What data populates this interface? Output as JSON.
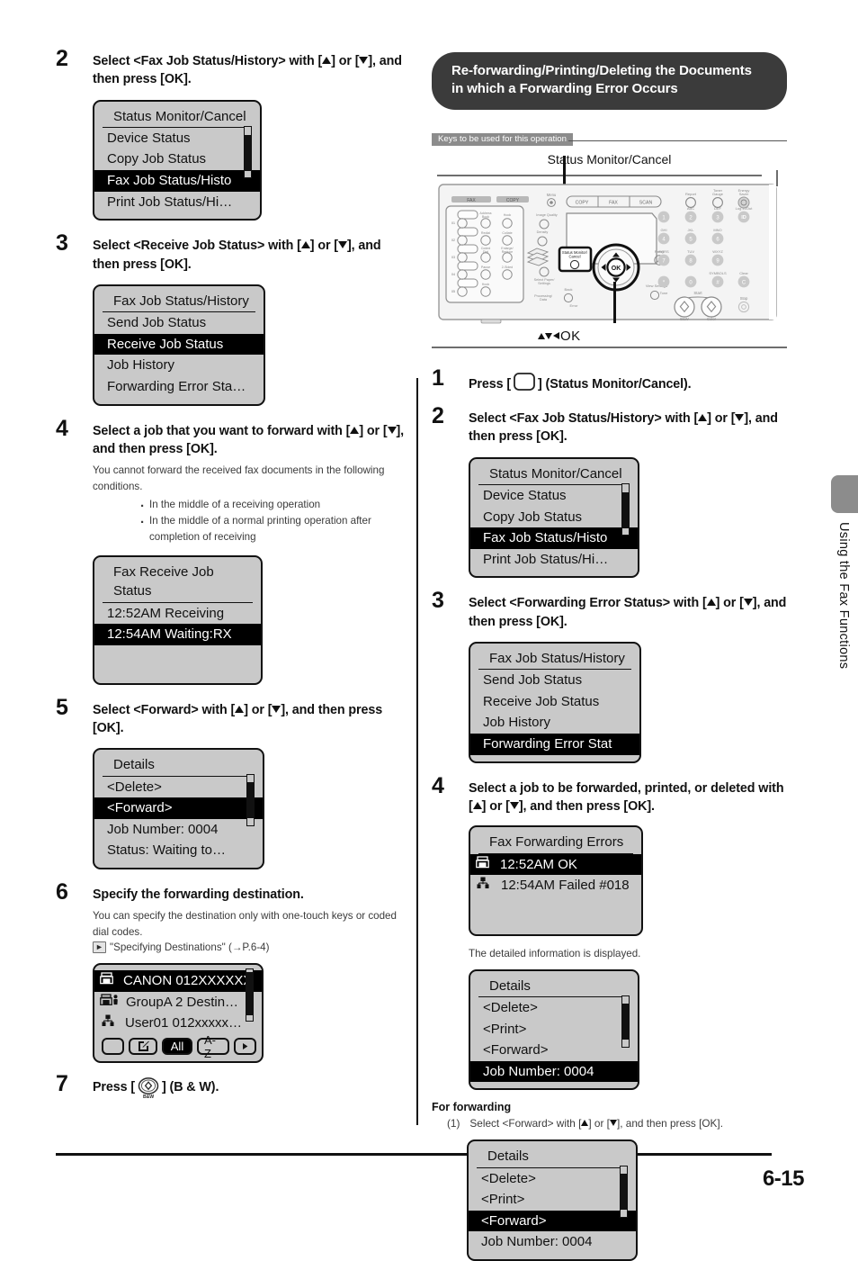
{
  "page": {
    "folio": "6-15",
    "side_tab_label": "Using the Fax Functions"
  },
  "left_column": {
    "steps": [
      {
        "num": "2",
        "title_parts": [
          "Select <Fax Job Status/History> with [",
          "] or [",
          "], and then press [OK]."
        ],
        "lcd": {
          "title": "Status Monitor/Cancel",
          "rows": [
            {
              "text": "Device Status",
              "selected": false
            },
            {
              "text": "Copy Job Status",
              "selected": false
            },
            {
              "text": "Fax Job Status/Histo",
              "selected": true
            },
            {
              "text": "Print Job Status/Hi…",
              "selected": false
            }
          ],
          "scrollbar": true
        }
      },
      {
        "num": "3",
        "title_parts": [
          "Select <Receive Job Status> with [",
          "] or [",
          "], and then press [OK]."
        ],
        "lcd": {
          "title": "Fax Job Status/History",
          "rows": [
            {
              "text": "Send Job Status",
              "selected": false
            },
            {
              "text": "Receive Job Status",
              "selected": true
            },
            {
              "text": "Job History",
              "selected": false
            },
            {
              "text": "Forwarding Error Sta…",
              "selected": false
            }
          ],
          "scrollbar": false
        }
      },
      {
        "num": "4",
        "title_parts": [
          "Select a job that you want to forward with [",
          "] or [",
          "], and then press [OK]."
        ],
        "note": "You cannot forward the received fax documents in the following conditions.",
        "bullets": [
          "In the middle of a receiving operation",
          "In the middle of a normal printing operation after completion of receiving"
        ],
        "lcd": {
          "title": "Fax Receive Job Status",
          "rows": [
            {
              "text": "12:52AM Receiving",
              "selected": false
            },
            {
              "text": "12:54AM Waiting:RX",
              "selected": true
            },
            {
              "text": "",
              "selected": false
            },
            {
              "text": "",
              "selected": false
            }
          ],
          "scrollbar": false
        }
      },
      {
        "num": "5",
        "title_parts": [
          "Select <Forward> with [",
          "] or [",
          "], and then press [OK]."
        ],
        "lcd": {
          "title": "Details",
          "rows": [
            {
              "text": "<Delete>",
              "selected": false
            },
            {
              "text": "<Forward>",
              "selected": true
            },
            {
              "text": "Job Number: 0004",
              "selected": false
            },
            {
              "text": "Status: Waiting to…",
              "selected": false
            }
          ],
          "scrollbar": true
        }
      },
      {
        "num": "6",
        "title": "Specify the forwarding destination.",
        "note": "You can specify the destination only with one-touch keys or coded dial codes.",
        "reference": "\"Specifying Destinations\" (→P.6-4)",
        "reference_icon": "arrow-chip-icon",
        "lcd_dest": {
          "rows": [
            {
              "icon": "fax-machine-icon",
              "text": "CANON 012XXXXXX",
              "selected": true
            },
            {
              "icon": "fax-group-icon",
              "text": "GroupA 2 Destin…",
              "selected": false
            },
            {
              "icon": "network-icon",
              "text": "User01 012xxxxx…",
              "selected": false
            }
          ],
          "keys": [
            {
              "label": "",
              "icon": "blank-key-icon",
              "active": false
            },
            {
              "label": "",
              "icon": "edit-pencil-icon",
              "active": false
            },
            {
              "label": "All",
              "icon": null,
              "active": true
            },
            {
              "label": "A-Z",
              "icon": null,
              "active": false
            },
            {
              "label": "",
              "icon": "play-arrow-icon",
              "active": false
            }
          ]
        }
      },
      {
        "num": "7",
        "title_prefix": "Press [",
        "title_suffix": "] (B & W).",
        "key_icon": "bw-start-key-icon"
      }
    ]
  },
  "right_column": {
    "banner": "Re-forwarding/Printing/Deleting the Documents in which a Forwarding Error Occurs",
    "keys_label": "Keys to be used for this operation",
    "panel_caption": "Status Monitor/Cancel",
    "panel_bottom_label": "OK",
    "panel": {
      "mode_buttons": [
        "COPY",
        "FAX",
        "SCAN"
      ],
      "menu_label": "Menu",
      "left_tabs": [
        "FAX",
        "COPY"
      ],
      "one_touch_ids": [
        "01",
        "02",
        "03",
        "04",
        "05"
      ],
      "left_keys": [
        [
          "Address Book",
          "Hook"
        ],
        [
          "Redial",
          "Collate"
        ],
        [
          "Coded Dial",
          "Enlarge/Reduce"
        ],
        [
          "Pause",
          "2-Sided"
        ],
        [
          "Hook",
          ""
        ]
      ],
      "mid_keys": [
        "Image Quality",
        "Density",
        "Select Paper/Settings",
        "Processing/Data"
      ],
      "status_key": "Status Monitor/Cancel",
      "reset_key": "Reset",
      "back_key": "Back",
      "error_key": "Error",
      "view_settings_key": "View Settings",
      "top_right_keys": [
        "Report",
        "Toner Gauge",
        "Energy Saver",
        "Log In/Out"
      ],
      "id_key": "ID",
      "keypad": [
        {
          "digit": "1",
          "letters": ""
        },
        {
          "digit": "2",
          "letters": "ABC"
        },
        {
          "digit": "3",
          "letters": "DEF"
        },
        {
          "digit": "4",
          "letters": "GHI"
        },
        {
          "digit": "5",
          "letters": "JKL"
        },
        {
          "digit": "6",
          "letters": "MNO"
        },
        {
          "digit": "7",
          "letters": "PQRS"
        },
        {
          "digit": "8",
          "letters": "TUV"
        },
        {
          "digit": "9",
          "letters": "WXYZ"
        },
        {
          "digit": "*",
          "letters": "Tone"
        },
        {
          "digit": "0",
          "letters": ""
        },
        {
          "digit": "#",
          "letters": "SYMBOLS"
        }
      ],
      "clear_key": "Clear",
      "clear_glyph": "C",
      "start_label": "Start",
      "start_bw": "B&W",
      "start_color": "Color",
      "stop_key": "Stop"
    },
    "steps": [
      {
        "num": "1",
        "title_prefix": "Press [",
        "title_suffix": "] (Status Monitor/Cancel).",
        "key_icon": "status-monitor-key-icon"
      },
      {
        "num": "2",
        "title_parts": [
          "Select <Fax Job Status/History> with [",
          "] or [",
          "], and then press [OK]."
        ],
        "lcd": {
          "title": "Status Monitor/Cancel",
          "rows": [
            {
              "text": "Device Status",
              "selected": false
            },
            {
              "text": "Copy Job Status",
              "selected": false
            },
            {
              "text": "Fax Job Status/Histo",
              "selected": true
            },
            {
              "text": "Print Job Status/Hi…",
              "selected": false
            }
          ],
          "scrollbar": true
        }
      },
      {
        "num": "3",
        "title_parts": [
          "Select <Forwarding Error Status> with [",
          "] or [",
          "], and then press [OK]."
        ],
        "lcd": {
          "title": "Fax Job Status/History",
          "rows": [
            {
              "text": "Send Job Status",
              "selected": false
            },
            {
              "text": "Receive Job Status",
              "selected": false
            },
            {
              "text": "Job History",
              "selected": false
            },
            {
              "text": "Forwarding Error Stat",
              "selected": true
            }
          ],
          "scrollbar": false
        }
      },
      {
        "num": "4",
        "title_parts": [
          "Select a job to be forwarded, printed, or deleted with [",
          "] or [",
          "], and then press [OK]."
        ],
        "lcd_errors": {
          "title": "Fax Forwarding Errors",
          "rows": [
            {
              "icon": "fax-machine-icon",
              "text": "12:52AM OK",
              "selected": true
            },
            {
              "icon": "network-icon",
              "text": "12:54AM Failed #018",
              "selected": false
            },
            {
              "icon": null,
              "text": "",
              "selected": false
            },
            {
              "icon": null,
              "text": "",
              "selected": false
            }
          ]
        },
        "detail_note": "The detailed information is displayed.",
        "lcd_details": {
          "title": "Details",
          "rows": [
            {
              "text": "<Delete>",
              "selected": false
            },
            {
              "text": "<Print>",
              "selected": false
            },
            {
              "text": "<Forward>",
              "selected": false
            },
            {
              "text": "Job Number: 0004",
              "selected": true
            }
          ],
          "scrollbar": true
        }
      }
    ],
    "for_forwarding": {
      "heading": "For forwarding",
      "item_number": "(1)",
      "item_parts": [
        "Select <Forward> with [",
        "] or [",
        "], and then press [OK]."
      ],
      "lcd": {
        "title": "Details",
        "rows": [
          {
            "text": "<Delete>",
            "selected": false
          },
          {
            "text": "<Print>",
            "selected": false
          },
          {
            "text": "<Forward>",
            "selected": true
          },
          {
            "text": "Job Number: 0004",
            "selected": false
          }
        ],
        "scrollbar": true
      }
    }
  }
}
